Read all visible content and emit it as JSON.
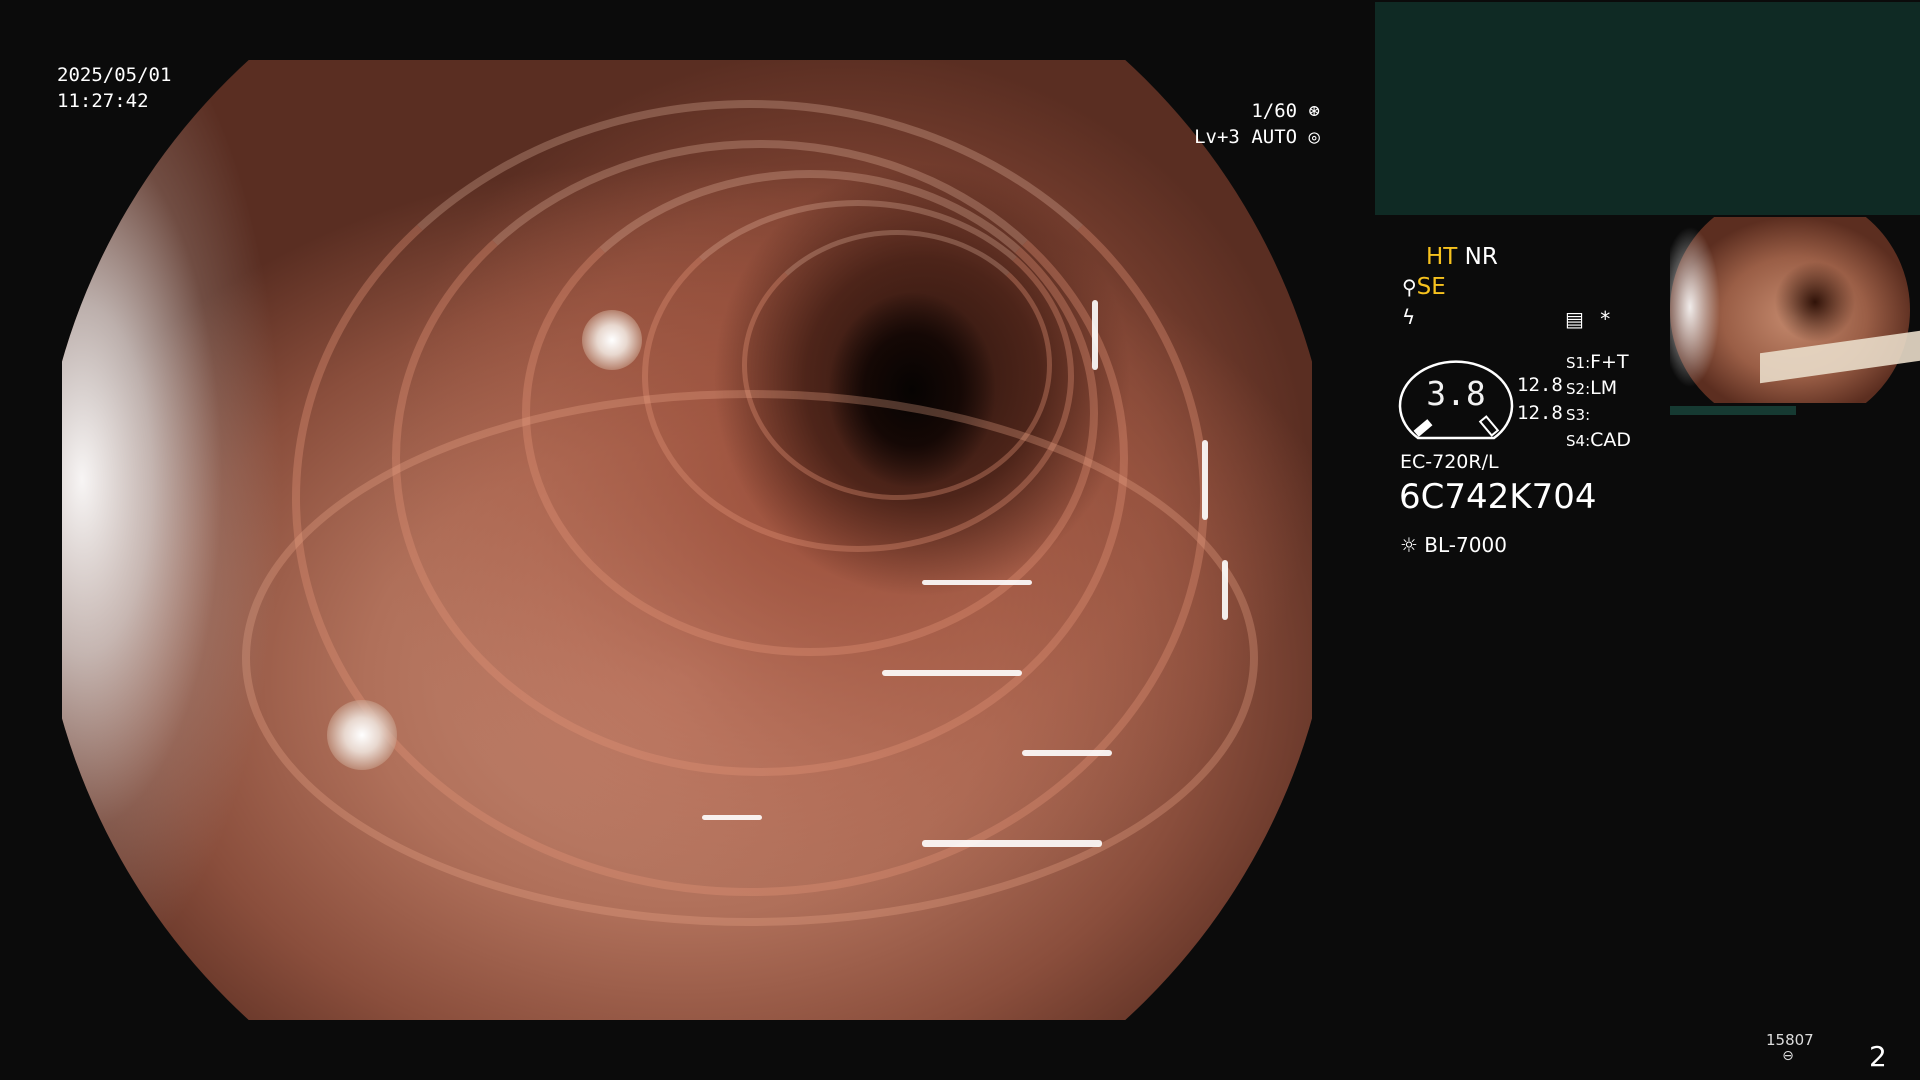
{
  "datetime": {
    "date": "2025/05/01",
    "time": "11:27:42"
  },
  "view_status": {
    "shutter": "1/60",
    "shutter_icon": "aperture-icon",
    "level": "Lv+3",
    "mode": "AUTO",
    "mode_icon": "iris-icon"
  },
  "settings": {
    "ht": "HT",
    "nr": "NR",
    "se": "SE",
    "se_icon": "brush-icon",
    "freeze_icon": "freeze-icon",
    "memo_icon": "settings-card-icon",
    "asterisk": "*"
  },
  "gauge": {
    "value": "3.8",
    "upper": "12.8",
    "lower": "12.8"
  },
  "switches": [
    {
      "key": "S1:",
      "value": "F+T"
    },
    {
      "key": "S2:",
      "value": "LM"
    },
    {
      "key": "S3:",
      "value": ""
    },
    {
      "key": "S4:",
      "value": "CAD"
    }
  ],
  "scope": {
    "model": "EC-720R/L",
    "serial": "6C742K704"
  },
  "light": {
    "icon": "sun-icon",
    "model": "BL-7000"
  },
  "footer": {
    "count": "15807",
    "count_icon": "storage-icon",
    "page": "2"
  },
  "colors": {
    "accent": "#f7c21e",
    "panel": "#0f2a24",
    "background": "#0b0b0b"
  }
}
